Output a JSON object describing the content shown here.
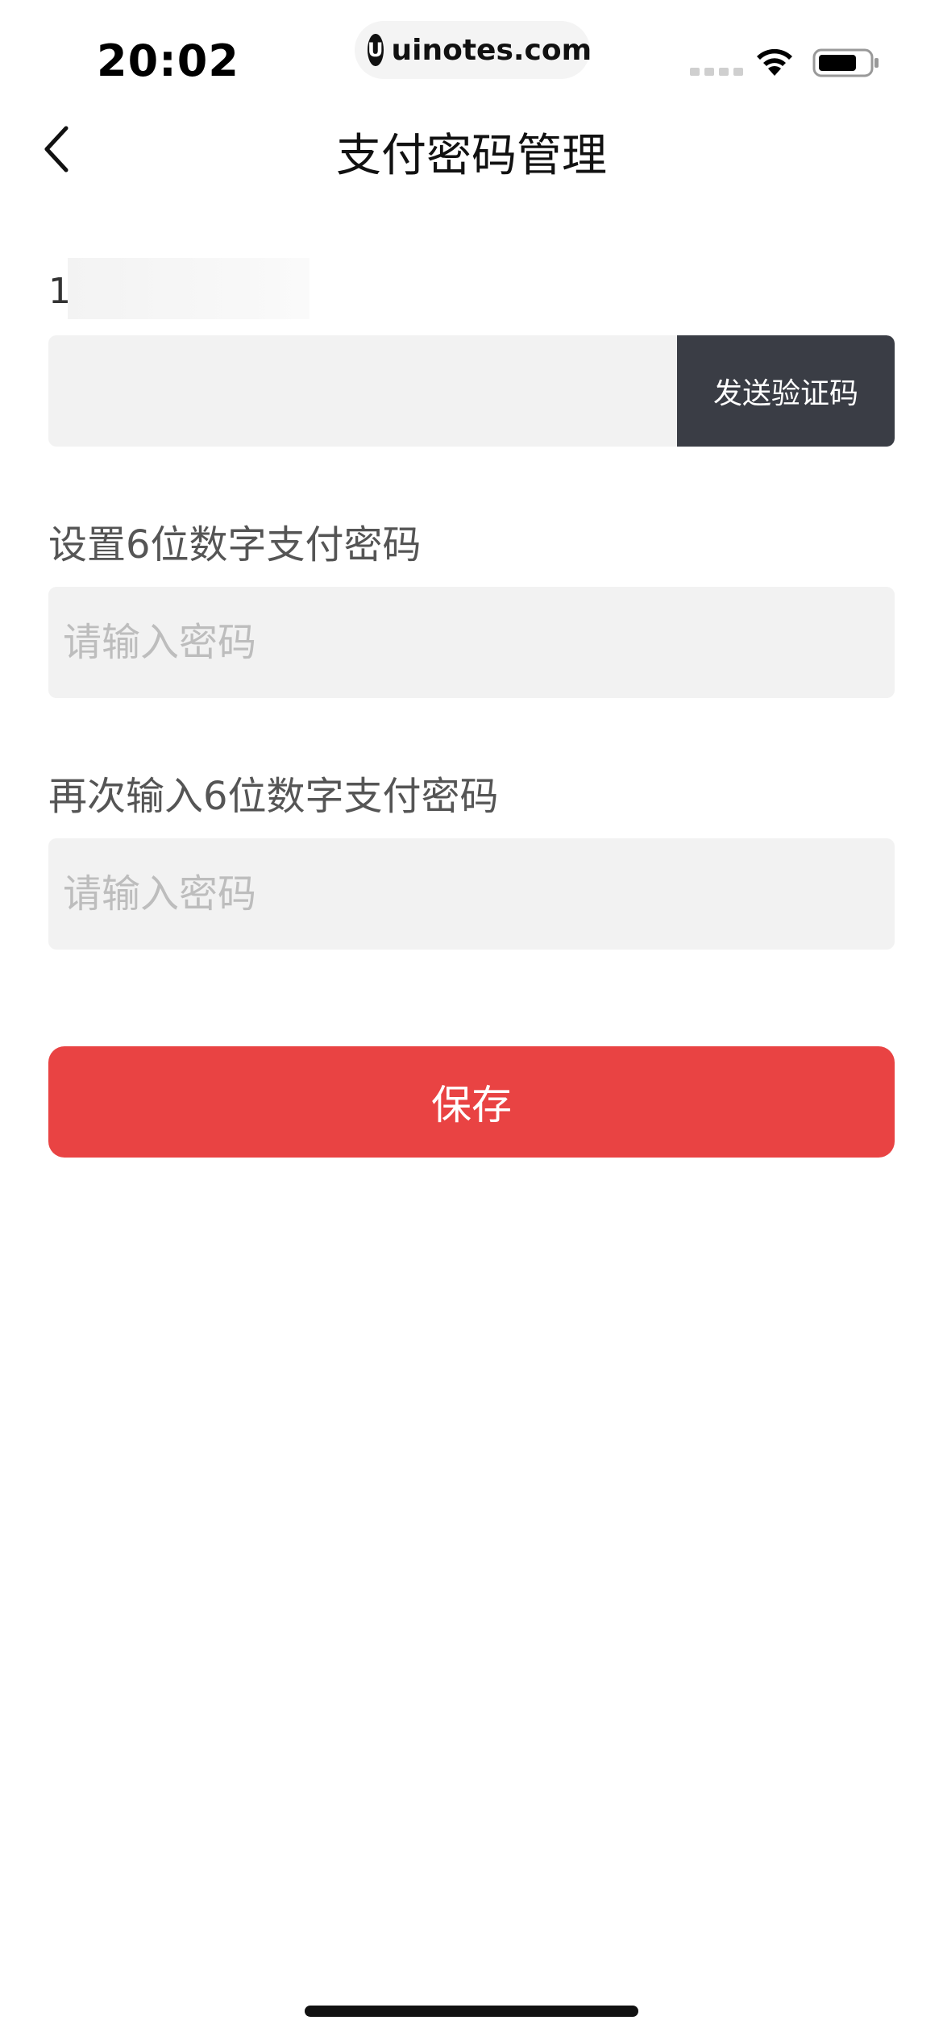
{
  "status_bar": {
    "time": "20:02",
    "url": "uinotes.com",
    "logo_glyph": "U"
  },
  "nav": {
    "title": "支付密码管理",
    "back_icon": "chevron-left-icon"
  },
  "form": {
    "phone_prefix": "1",
    "code_input": {
      "value": "",
      "placeholder": ""
    },
    "send_code_label": "发送验证码",
    "set_password_label": "设置6位数字支付密码",
    "set_password_placeholder": "请输入密码",
    "confirm_password_label": "再次输入6位数字支付密码",
    "confirm_password_placeholder": "请输入密码",
    "save_label": "保存"
  },
  "colors": {
    "primary_red": "#e94343",
    "send_button_bg": "#3a3d45",
    "field_bg": "#f2f2f2",
    "placeholder": "#bdbdbd"
  }
}
